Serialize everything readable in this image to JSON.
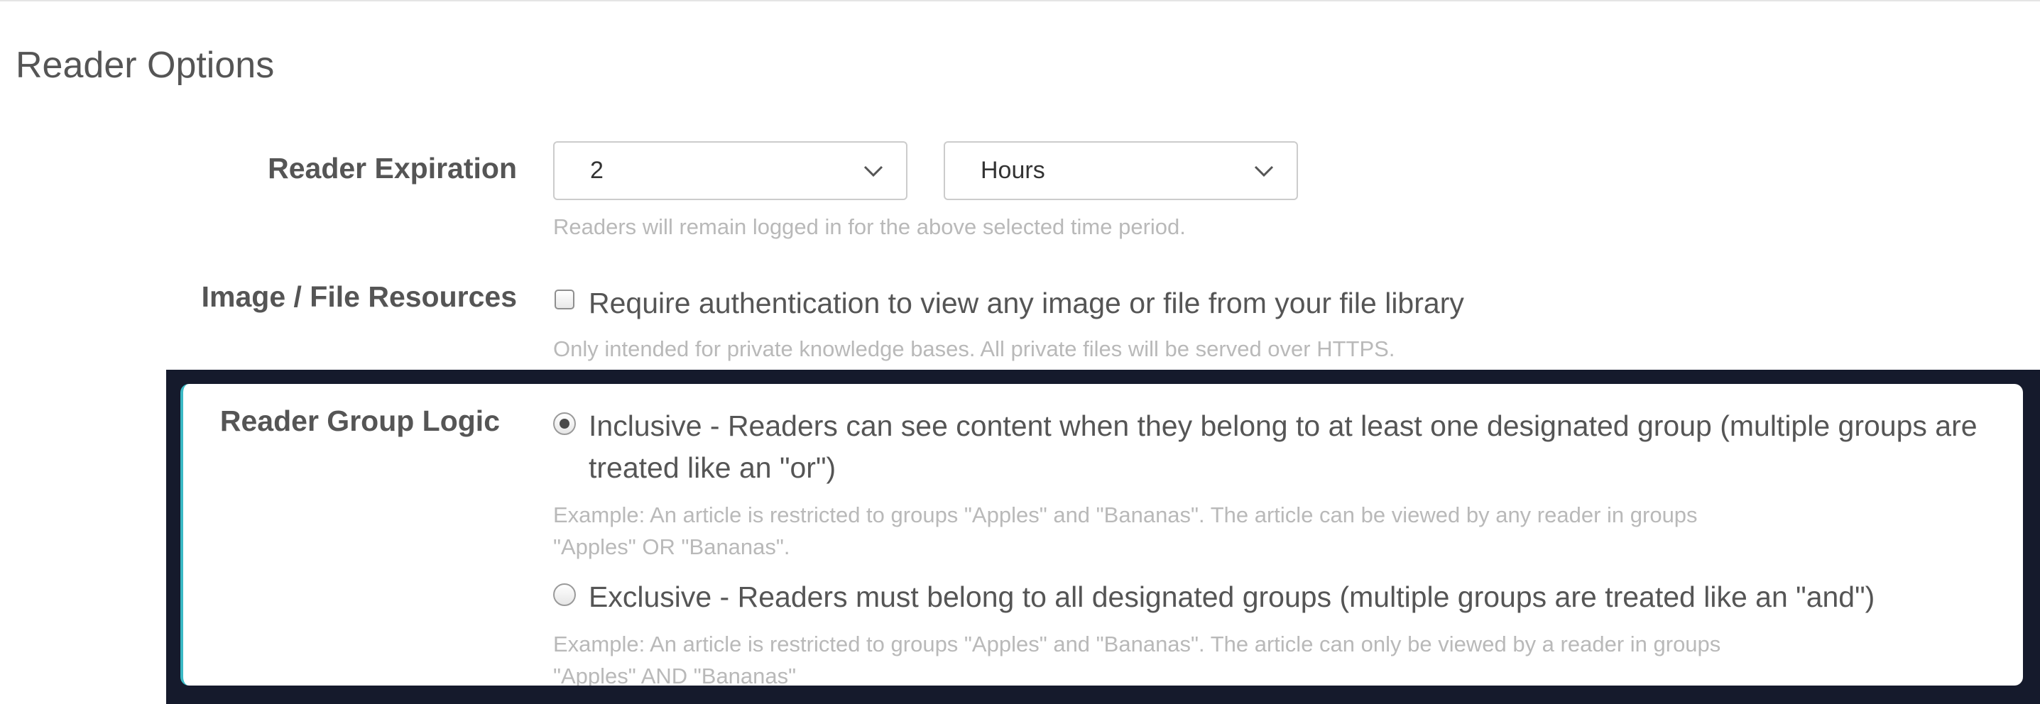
{
  "section": {
    "title": "Reader Options"
  },
  "expiration": {
    "label": "Reader Expiration",
    "amount_value": "2",
    "unit_value": "Hours",
    "help": "Readers will remain logged in for the above selected time period."
  },
  "resources": {
    "label": "Image / File Resources",
    "checkbox_label": "Require authentication to view any image or file from your file library",
    "checked": false,
    "help": "Only intended for private knowledge bases. All private files will be served over HTTPS."
  },
  "group_logic": {
    "label": "Reader Group Logic",
    "inclusive": {
      "line1": "Inclusive - Readers can see content when they belong to at least one designated group (multiple groups are",
      "line2": "treated like an \"or\")",
      "help_line1": "Example: An article is restricted to groups \"Apples\" and \"Bananas\". The article can be viewed by any reader in groups",
      "help_line2": "\"Apples\" OR \"Bananas\".",
      "selected": true
    },
    "exclusive": {
      "line1": "Exclusive - Readers must belong to all designated groups (multiple groups are treated like an \"and\")",
      "help_line1": "Example: An article is restricted to groups \"Apples\" and \"Bananas\". The article can only be viewed by a reader in groups",
      "help_line2": "\"Apples\" AND \"Bananas\"",
      "selected": false
    }
  },
  "colors": {
    "highlight_frame": "#151a2c",
    "highlight_accent": "#3ab8c4",
    "help_text": "#b9b9b9"
  },
  "icons": {
    "select_arrow": "chevron-down-icon"
  }
}
